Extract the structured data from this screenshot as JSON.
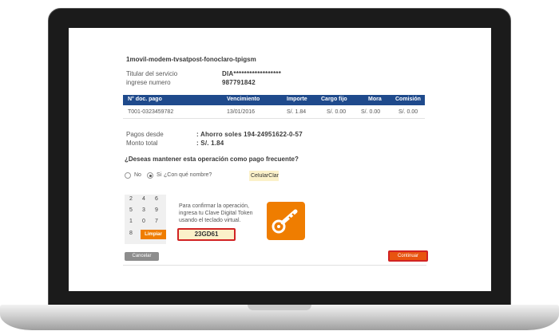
{
  "service": {
    "title": "1movil-modem-tvsatpost-fonoclaro-tpigsm",
    "holder_label": "Titular del servicio",
    "holder_value": "DIA******************",
    "number_label": "ingrese numero",
    "number_value": "987791842"
  },
  "table": {
    "headers": [
      "N° doc. pago",
      "Vencimiento",
      "Importe",
      "Cargo fijo",
      "Mora",
      "Comisión"
    ],
    "rows": [
      [
        "T001-0323459782",
        "13/01/2016",
        "S/. 1.84",
        "S/. 0.00",
        "S/. 0.00",
        "S/. 0.00"
      ]
    ]
  },
  "payment": {
    "from_label": "Pagos desde",
    "from_value": ": Ahorro soles 194-24951622-0-57",
    "total_label": "Monto total",
    "total_value": ": S/. 1.84"
  },
  "frequent": {
    "question": "¿Deseas mantener esta operación como pago frecuente?",
    "no_label": "No",
    "yes_label": "Si",
    "name_prompt": "¿Con qué nombre?",
    "name_value": "CelularClaro",
    "selected": "Si"
  },
  "token": {
    "keypad": [
      "2",
      "4",
      "6",
      "5",
      "3",
      "9",
      "1",
      "0",
      "7",
      "8"
    ],
    "clear_label": "Limpiar",
    "instruction": "Para confirmar la operación, ingresa tu Clave Digital Token usando el teclado virtual.",
    "code": "23GD61",
    "icon": "key-icon"
  },
  "actions": {
    "cancel_label": "Cancelar",
    "continue_label": "Continuar"
  },
  "colors": {
    "table_header": "#1f4a8c",
    "accent_orange": "#ef7d00",
    "highlight_red": "#d12323",
    "input_bg": "#fbf1c9"
  }
}
